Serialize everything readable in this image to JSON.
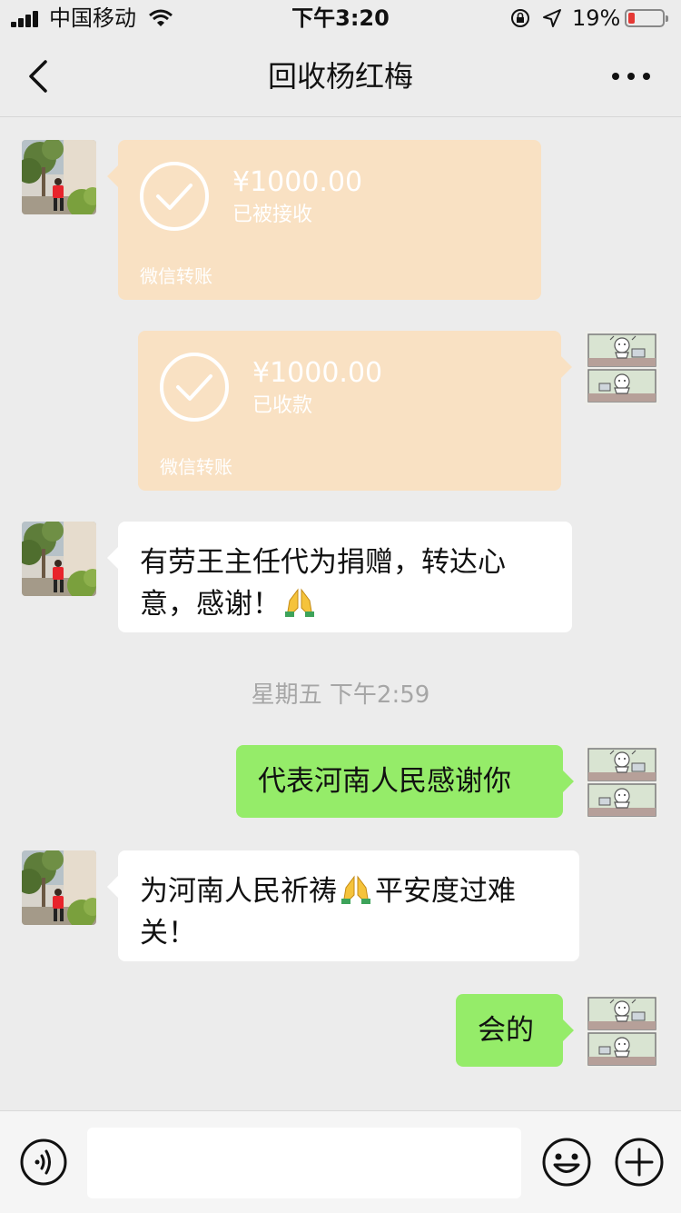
{
  "status_bar": {
    "carrier": "中国移动",
    "time": "下午3:20",
    "battery_pct": "19%",
    "battery_level": 0.19
  },
  "nav": {
    "title": "回收杨红梅",
    "back_icon": "chevron-left-icon",
    "more_icon": "ellipsis-icon"
  },
  "messages": [
    {
      "side": "left",
      "type": "transfer",
      "amount": "¥1000.00",
      "status": "已被接收",
      "source": "微信转账"
    },
    {
      "side": "right",
      "type": "transfer",
      "amount": "¥1000.00",
      "status": "已收款",
      "source": "微信转账"
    },
    {
      "side": "left",
      "type": "text",
      "text_before": "有劳王主任代为捐赠，转达心意，感谢！",
      "emoji": "folded-hands-icon"
    },
    {
      "side": "right",
      "type": "text",
      "text": "代表河南人民感谢你"
    },
    {
      "side": "left",
      "type": "text",
      "text_before": "为河南人民祈祷",
      "emoji": "folded-hands-icon",
      "text_after": "平安度过难关！"
    },
    {
      "side": "right",
      "type": "text",
      "text": "会的"
    }
  ],
  "timestamp": "星期五 下午2:59",
  "input_bar": {
    "placeholder": "",
    "voice_icon": "voice-icon",
    "emoji_icon": "smiley-icon",
    "add_icon": "plus-circle-icon"
  },
  "colors": {
    "background": "#ececec",
    "transfer_bubble": "#f9e1c3",
    "self_bubble": "#95ec69",
    "friend_bubble": "#ffffff",
    "battery_low": "#e53935"
  }
}
